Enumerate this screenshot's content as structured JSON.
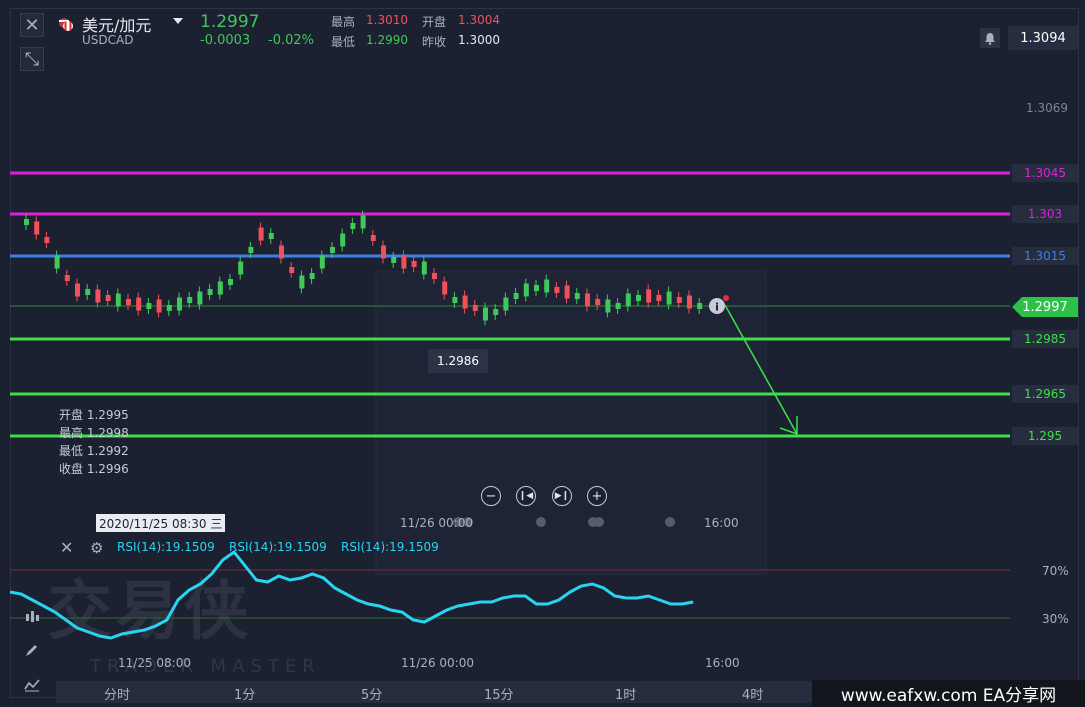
{
  "header": {
    "symbol_name": "美元/加元",
    "symbol_code": "USDCAD",
    "last_price": "1.2997",
    "change": "-0.0003",
    "change_pct": "-0.02%",
    "high_label": "最高",
    "high_value": "1.3010",
    "open_label": "开盘",
    "open_value": "1.3004",
    "low_label": "最低",
    "low_value": "1.2990",
    "prev_close_label": "昨收",
    "prev_close_value": "1.3000",
    "ask_price": "1.3094"
  },
  "price_axis": {
    "labels": [
      "1.3069",
      "1.3015"
    ],
    "current_tag": "1.2997"
  },
  "levels": [
    {
      "label": "1.3045",
      "color": "#e020d8"
    },
    {
      "label": "1.303",
      "color": "#e020d8"
    },
    {
      "label": "1.3015",
      "color": "#3f7ee8"
    },
    {
      "label": "1.2985",
      "color": "#3ee04a"
    },
    {
      "label": "1.2965",
      "color": "#3ee04a"
    },
    {
      "label": "1.295",
      "color": "#3ee04a"
    }
  ],
  "tooltip_low": "1.2986",
  "candle_ohlc": {
    "open": "开盘 1.2995",
    "high": "最高 1.2998",
    "low": "最低 1.2992",
    "close": "收盘 1.2996"
  },
  "crosshair_date": "2020/11/25 08:30 三",
  "time_axis": {
    "main": [
      "11/26 00:00",
      "16:00"
    ],
    "rsi": [
      "11/25 08:00",
      "11/26 00:00",
      "16:00"
    ]
  },
  "rsi": {
    "labels": [
      "RSI(14):19.1509",
      "RSI(14):19.1509",
      "RSI(14):19.1509"
    ],
    "level_high": "70%",
    "level_low": "30%"
  },
  "timeframes": [
    "分时",
    "1分",
    "5分",
    "15分",
    "1时",
    "4时"
  ],
  "watermark": {
    "main": "交易侠",
    "sub": "TRADER MASTER"
  },
  "site_tag": "www.eafxw.com  EA分享网",
  "colors": {
    "up": "#3ec95a",
    "down": "#f0505a",
    "rsi": "#2ad4f0"
  },
  "icons": [
    "close-icon",
    "collapse-icon",
    "flag-icon",
    "bell-icon",
    "info-icon",
    "zoom-out-icon",
    "step-back-icon",
    "step-forward-icon",
    "zoom-in-icon",
    "settings-icon"
  ]
}
